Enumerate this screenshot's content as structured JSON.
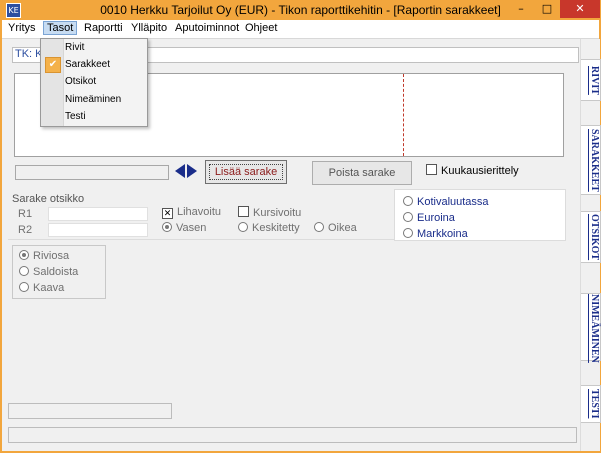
{
  "window": {
    "title": "0010  Herkku Tarjoilut Oy (EUR) - Tikon raporttikehitin - [Raportin sarakkeet]",
    "app_icon_text": "KE",
    "minimize_glyph": "–",
    "maximize_glyph": "□",
    "close_glyph": "✕"
  },
  "menubar": {
    "items": [
      "Yritys",
      "Tasot",
      "Raportti",
      "Ylläpito",
      "Aputoiminnot",
      "Ohjeet"
    ],
    "active": "Tasot"
  },
  "dropdown": {
    "items": [
      "Rivit",
      "Sarakkeet",
      "Otsikot",
      "Nimeäminen",
      "Testi"
    ],
    "checked": "Sarakkeet",
    "check_glyph": "✔"
  },
  "tk_bar": {
    "label": "TK: K"
  },
  "buttons": {
    "add_column": "Lisää sarake",
    "remove_column": "Poista sarake"
  },
  "monthly": {
    "label": "Kuukausierittely",
    "checked": false
  },
  "column_header": {
    "title": "Sarake otsikko",
    "r1_label": "R1",
    "r2_label": "R2"
  },
  "formatting": {
    "bold_label": "Lihavoitu",
    "bold_checked": true,
    "italic_label": "Kursivoitu",
    "italic_checked": false,
    "check_glyph": "✕",
    "align_left": "Vasen",
    "align_center": "Keskitetty",
    "align_right": "Oikea",
    "align_selected": "Vasen"
  },
  "currency": {
    "options": [
      "Kotivaluutassa",
      "Euroina",
      "Markkoina"
    ]
  },
  "row_type": {
    "options": [
      "Riviosa",
      "Saldoista",
      "Kaava"
    ],
    "selected": "Riviosa"
  },
  "side_tabs": [
    "RIVIT",
    "SARAKKEET",
    "OTSIKOT",
    "NIMEÄMINEN",
    "TESTI"
  ],
  "colors": {
    "title_bar": "#f2a63d",
    "close_button": "#c8372b",
    "side_tab_text": "#1a2d8a",
    "divider": "#c0392b"
  }
}
